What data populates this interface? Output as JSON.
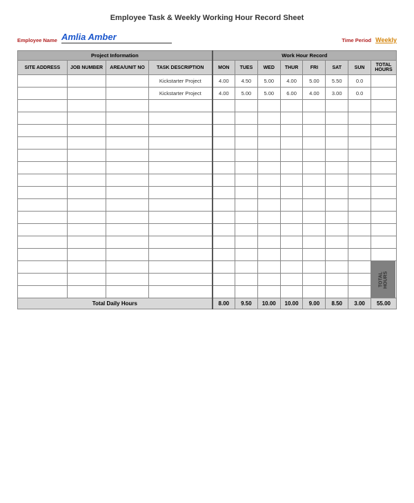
{
  "page": {
    "title": "Employee Task & Weekly Working Hour Record Sheet",
    "employee_label": "Employee Name",
    "employee_name": "Amlia Amber",
    "time_period_label": "Time Period",
    "time_period_value": "Weekly",
    "project_header": "Project Information",
    "workhour_header": "Work Hour Record",
    "columns": {
      "site_address": "SITE ADDRESS",
      "job_number": "JOB NUMBER",
      "area_unit": "AREA/UNIT NO",
      "task_description": "TASK DESCRIPTION",
      "mon": "MON",
      "tue": "TUES",
      "wed": "WED",
      "thu": "THUR",
      "fri": "FRI",
      "sat": "SAT",
      "sun": "SUN",
      "total_hours": "TOTAL HOURS"
    },
    "rows": [
      {
        "site": "",
        "job": "",
        "area": "",
        "task": "Kickstarter Project",
        "mon": "4.00",
        "tue": "4.50",
        "wed": "5.00",
        "thu": "4.00",
        "fri": "5.00",
        "sat": "5.50",
        "sun": "0.0",
        "total": ""
      },
      {
        "site": "",
        "job": "",
        "area": "",
        "task": "Kickstarter Project",
        "mon": "4.00",
        "tue": "5.00",
        "wed": "5.00",
        "thu": "6.00",
        "fri": "4.00",
        "sat": "3.00",
        "sun": "0.0",
        "total": ""
      },
      {
        "site": "",
        "job": "",
        "area": "",
        "task": "",
        "mon": "",
        "tue": "",
        "wed": "",
        "thu": "",
        "fri": "",
        "sat": "",
        "sun": "",
        "total": ""
      },
      {
        "site": "",
        "job": "",
        "area": "",
        "task": "",
        "mon": "",
        "tue": "",
        "wed": "",
        "thu": "",
        "fri": "",
        "sat": "",
        "sun": "",
        "total": ""
      },
      {
        "site": "",
        "job": "",
        "area": "",
        "task": "",
        "mon": "",
        "tue": "",
        "wed": "",
        "thu": "",
        "fri": "",
        "sat": "",
        "sun": "",
        "total": ""
      },
      {
        "site": "",
        "job": "",
        "area": "",
        "task": "",
        "mon": "",
        "tue": "",
        "wed": "",
        "thu": "",
        "fri": "",
        "sat": "",
        "sun": "",
        "total": ""
      },
      {
        "site": "",
        "job": "",
        "area": "",
        "task": "",
        "mon": "",
        "tue": "",
        "wed": "",
        "thu": "",
        "fri": "",
        "sat": "",
        "sun": "",
        "total": ""
      },
      {
        "site": "",
        "job": "",
        "area": "",
        "task": "",
        "mon": "",
        "tue": "",
        "wed": "",
        "thu": "",
        "fri": "",
        "sat": "",
        "sun": "",
        "total": ""
      },
      {
        "site": "",
        "job": "",
        "area": "",
        "task": "",
        "mon": "",
        "tue": "",
        "wed": "",
        "thu": "",
        "fri": "",
        "sat": "",
        "sun": "",
        "total": ""
      },
      {
        "site": "",
        "job": "",
        "area": "",
        "task": "",
        "mon": "",
        "tue": "",
        "wed": "",
        "thu": "",
        "fri": "",
        "sat": "",
        "sun": "",
        "total": ""
      },
      {
        "site": "",
        "job": "",
        "area": "",
        "task": "",
        "mon": "",
        "tue": "",
        "wed": "",
        "thu": "",
        "fri": "",
        "sat": "",
        "sun": "",
        "total": ""
      },
      {
        "site": "",
        "job": "",
        "area": "",
        "task": "",
        "mon": "",
        "tue": "",
        "wed": "",
        "thu": "",
        "fri": "",
        "sat": "",
        "sun": "",
        "total": ""
      },
      {
        "site": "",
        "job": "",
        "area": "",
        "task": "",
        "mon": "",
        "tue": "",
        "wed": "",
        "thu": "",
        "fri": "",
        "sat": "",
        "sun": "",
        "total": ""
      },
      {
        "site": "",
        "job": "",
        "area": "",
        "task": "",
        "mon": "",
        "tue": "",
        "wed": "",
        "thu": "",
        "fri": "",
        "sat": "",
        "sun": "",
        "total": ""
      },
      {
        "site": "",
        "job": "",
        "area": "",
        "task": "",
        "mon": "",
        "tue": "",
        "wed": "",
        "thu": "",
        "fri": "",
        "sat": "",
        "sun": "",
        "total": ""
      },
      {
        "site": "",
        "job": "",
        "area": "",
        "task": "",
        "mon": "",
        "tue": "",
        "wed": "",
        "thu": "",
        "fri": "",
        "sat": "",
        "sun": "",
        "total": ""
      },
      {
        "site": "",
        "job": "",
        "area": "",
        "task": "",
        "mon": "",
        "tue": "",
        "wed": "",
        "thu": "",
        "fri": "",
        "sat": "",
        "sun": "",
        "total": ""
      },
      {
        "site": "",
        "job": "",
        "area": "",
        "task": "",
        "mon": "",
        "tue": "",
        "wed": "",
        "thu": "",
        "fri": "",
        "sat": "",
        "sun": "",
        "total": ""
      }
    ],
    "totals": {
      "label": "Total Daily Hours",
      "mon": "8.00",
      "tue": "9.50",
      "wed": "10.00",
      "thu": "10.00",
      "fri": "9.00",
      "sat": "8.50",
      "sun": "3.00",
      "total": "55.00"
    }
  }
}
